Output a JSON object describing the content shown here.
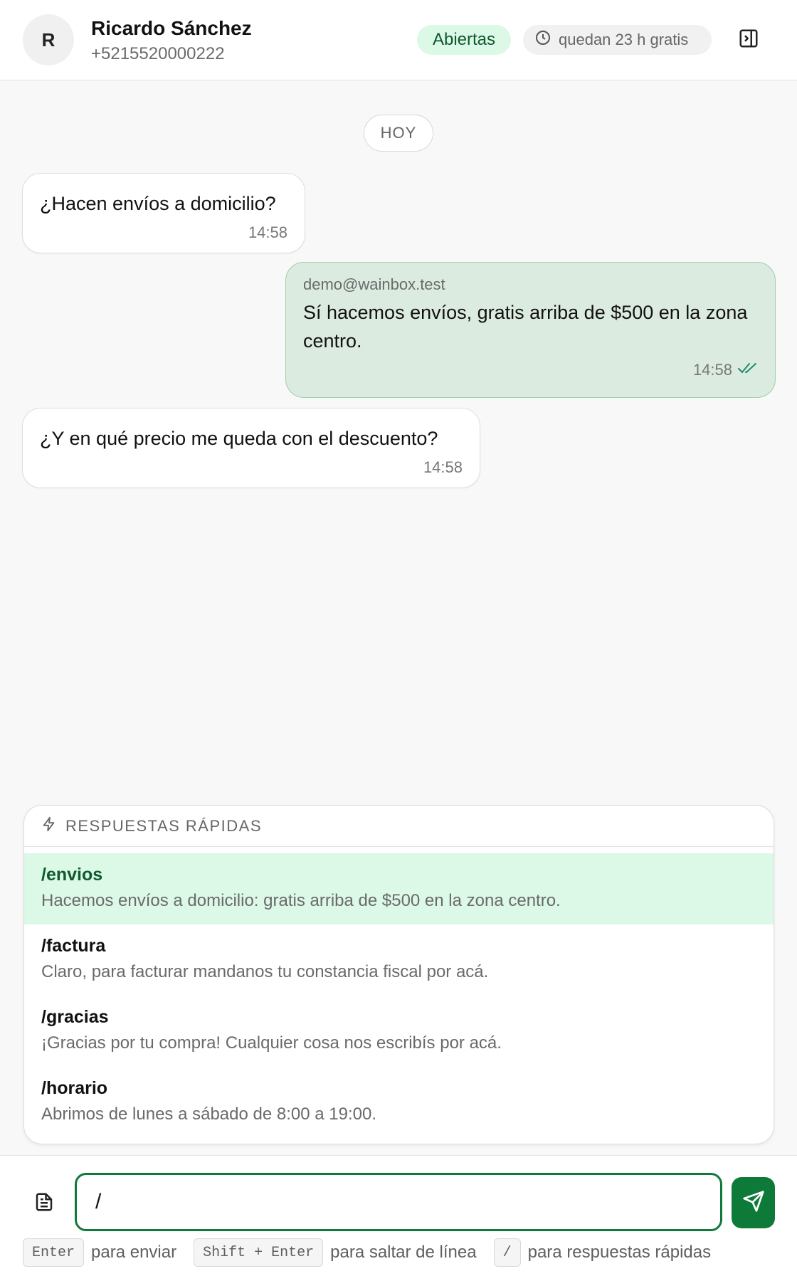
{
  "header": {
    "avatar_initial": "R",
    "name": "Ricardo Sánchez",
    "phone": "+5215520000222",
    "status": "Abiertas",
    "window_text": "quedan 23 h gratis"
  },
  "day_label": "HOY",
  "messages": [
    {
      "direction": "in",
      "text": "¿Hacen envíos a domicilio?",
      "time": "14:58"
    },
    {
      "direction": "out",
      "sender": "demo@wainbox.test",
      "text": "Sí hacemos envíos, gratis arriba de $500 en la zona centro.",
      "time": "14:58",
      "status": "read"
    },
    {
      "direction": "in",
      "text": "¿Y en qué precio me queda con el descuento?",
      "time": "14:58"
    }
  ],
  "quick_replies": {
    "title": "RESPUESTAS RÁPIDAS",
    "items": [
      {
        "command": "/envios",
        "text": "Hacemos envíos a domicilio: gratis arriba de $500 en la zona centro.",
        "active": true
      },
      {
        "command": "/factura",
        "text": "Claro, para facturar mandanos tu constancia fiscal por acá."
      },
      {
        "command": "/gracias",
        "text": "¡Gracias por tu compra! Cualquier cosa nos escribís por acá."
      },
      {
        "command": "/horario",
        "text": "Abrimos de lunes a sábado de 8:00 a 19:00."
      }
    ]
  },
  "composer": {
    "value": "/",
    "hints": [
      {
        "key": "Enter",
        "text": "para enviar"
      },
      {
        "key": "Shift + Enter",
        "text": "para saltar de línea"
      },
      {
        "key": "/",
        "text": "para respuestas rápidas"
      }
    ]
  },
  "colors": {
    "accent": "#0e7a3a",
    "active_bg": "#dcf8e6",
    "outgoing_bg": "#dcebdf"
  }
}
